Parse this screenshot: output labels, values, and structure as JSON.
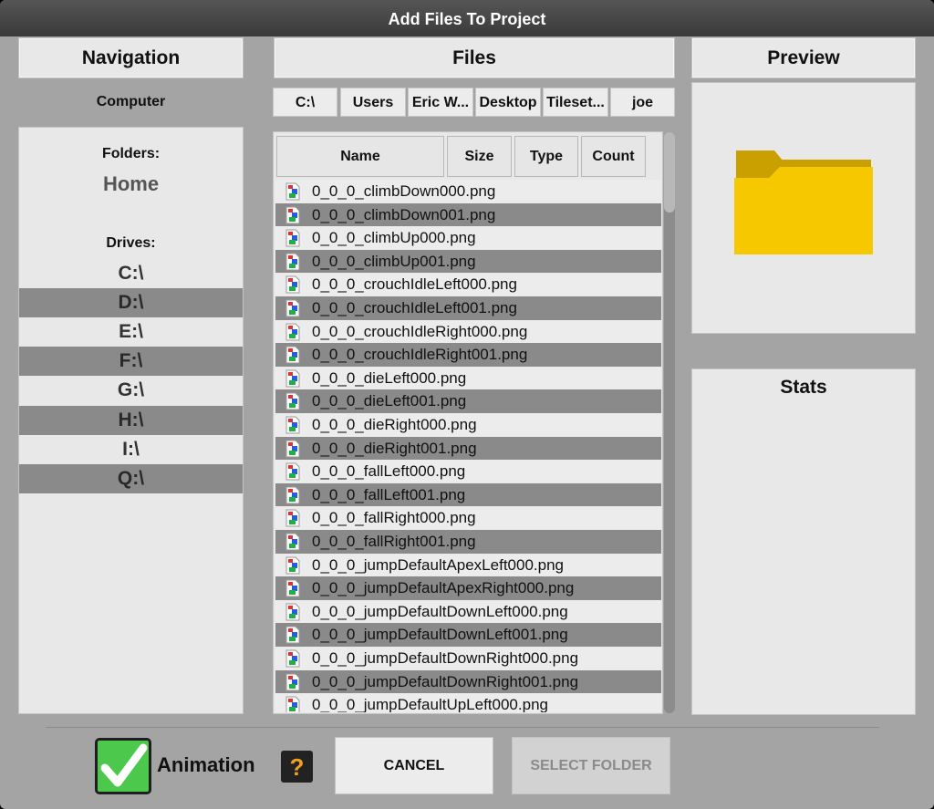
{
  "window": {
    "title": "Add Files To Project"
  },
  "navigation": {
    "header": "Navigation",
    "location": "Computer",
    "folders_label": "Folders:",
    "home": "Home",
    "drives_label": "Drives:",
    "drives": [
      "C:\\",
      "D:\\",
      "E:\\",
      "F:\\",
      "G:\\",
      "H:\\",
      "I:\\",
      "Q:\\"
    ]
  },
  "files": {
    "header": "Files",
    "breadcrumb": [
      "C:\\",
      "Users",
      "Eric W...",
      "Desktop",
      "Tileset...",
      "joe"
    ],
    "columns": [
      "Name",
      "Size",
      "Type",
      "Count"
    ],
    "file_icon": "image-file-icon",
    "items": [
      "0_0_0_climbDown000.png",
      "0_0_0_climbDown001.png",
      "0_0_0_climbUp000.png",
      "0_0_0_climbUp001.png",
      "0_0_0_crouchIdleLeft000.png",
      "0_0_0_crouchIdleLeft001.png",
      "0_0_0_crouchIdleRight000.png",
      "0_0_0_crouchIdleRight001.png",
      "0_0_0_dieLeft000.png",
      "0_0_0_dieLeft001.png",
      "0_0_0_dieRight000.png",
      "0_0_0_dieRight001.png",
      "0_0_0_fallLeft000.png",
      "0_0_0_fallLeft001.png",
      "0_0_0_fallRight000.png",
      "0_0_0_fallRight001.png",
      "0_0_0_jumpDefaultApexLeft000.png",
      "0_0_0_jumpDefaultApexRight000.png",
      "0_0_0_jumpDefaultDownLeft000.png",
      "0_0_0_jumpDefaultDownLeft001.png",
      "0_0_0_jumpDefaultDownRight000.png",
      "0_0_0_jumpDefaultDownRight001.png",
      "0_0_0_jumpDefaultUpLeft000.png"
    ]
  },
  "preview": {
    "header": "Preview",
    "icon": "folder-icon",
    "folder_color": "#f5c800"
  },
  "stats": {
    "header": "Stats"
  },
  "footer": {
    "animation_label": "Animation",
    "animation_checked": true,
    "help_icon": "?",
    "cancel_label": "CANCEL",
    "select_label": "SELECT FOLDER"
  },
  "colors": {
    "row_alt": "#8a8a8a",
    "row": "#ececec",
    "checkbox": "#4cc84c",
    "help": "#f0a020"
  }
}
